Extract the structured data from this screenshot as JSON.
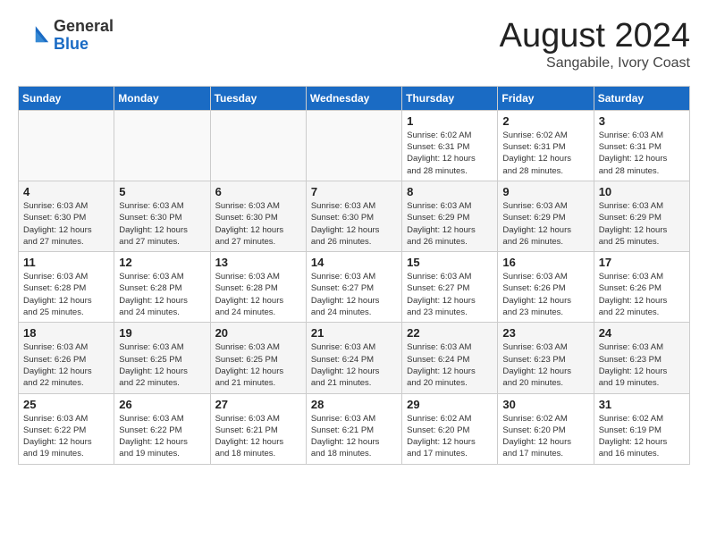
{
  "header": {
    "logo_general": "General",
    "logo_blue": "Blue",
    "month_title": "August 2024",
    "location": "Sangabile, Ivory Coast"
  },
  "calendar": {
    "days_of_week": [
      "Sunday",
      "Monday",
      "Tuesday",
      "Wednesday",
      "Thursday",
      "Friday",
      "Saturday"
    ],
    "weeks": [
      [
        {
          "day": "",
          "info": ""
        },
        {
          "day": "",
          "info": ""
        },
        {
          "day": "",
          "info": ""
        },
        {
          "day": "",
          "info": ""
        },
        {
          "day": "1",
          "info": "Sunrise: 6:02 AM\nSunset: 6:31 PM\nDaylight: 12 hours\nand 28 minutes."
        },
        {
          "day": "2",
          "info": "Sunrise: 6:02 AM\nSunset: 6:31 PM\nDaylight: 12 hours\nand 28 minutes."
        },
        {
          "day": "3",
          "info": "Sunrise: 6:03 AM\nSunset: 6:31 PM\nDaylight: 12 hours\nand 28 minutes."
        }
      ],
      [
        {
          "day": "4",
          "info": "Sunrise: 6:03 AM\nSunset: 6:30 PM\nDaylight: 12 hours\nand 27 minutes."
        },
        {
          "day": "5",
          "info": "Sunrise: 6:03 AM\nSunset: 6:30 PM\nDaylight: 12 hours\nand 27 minutes."
        },
        {
          "day": "6",
          "info": "Sunrise: 6:03 AM\nSunset: 6:30 PM\nDaylight: 12 hours\nand 27 minutes."
        },
        {
          "day": "7",
          "info": "Sunrise: 6:03 AM\nSunset: 6:30 PM\nDaylight: 12 hours\nand 26 minutes."
        },
        {
          "day": "8",
          "info": "Sunrise: 6:03 AM\nSunset: 6:29 PM\nDaylight: 12 hours\nand 26 minutes."
        },
        {
          "day": "9",
          "info": "Sunrise: 6:03 AM\nSunset: 6:29 PM\nDaylight: 12 hours\nand 26 minutes."
        },
        {
          "day": "10",
          "info": "Sunrise: 6:03 AM\nSunset: 6:29 PM\nDaylight: 12 hours\nand 25 minutes."
        }
      ],
      [
        {
          "day": "11",
          "info": "Sunrise: 6:03 AM\nSunset: 6:28 PM\nDaylight: 12 hours\nand 25 minutes."
        },
        {
          "day": "12",
          "info": "Sunrise: 6:03 AM\nSunset: 6:28 PM\nDaylight: 12 hours\nand 24 minutes."
        },
        {
          "day": "13",
          "info": "Sunrise: 6:03 AM\nSunset: 6:28 PM\nDaylight: 12 hours\nand 24 minutes."
        },
        {
          "day": "14",
          "info": "Sunrise: 6:03 AM\nSunset: 6:27 PM\nDaylight: 12 hours\nand 24 minutes."
        },
        {
          "day": "15",
          "info": "Sunrise: 6:03 AM\nSunset: 6:27 PM\nDaylight: 12 hours\nand 23 minutes."
        },
        {
          "day": "16",
          "info": "Sunrise: 6:03 AM\nSunset: 6:26 PM\nDaylight: 12 hours\nand 23 minutes."
        },
        {
          "day": "17",
          "info": "Sunrise: 6:03 AM\nSunset: 6:26 PM\nDaylight: 12 hours\nand 22 minutes."
        }
      ],
      [
        {
          "day": "18",
          "info": "Sunrise: 6:03 AM\nSunset: 6:26 PM\nDaylight: 12 hours\nand 22 minutes."
        },
        {
          "day": "19",
          "info": "Sunrise: 6:03 AM\nSunset: 6:25 PM\nDaylight: 12 hours\nand 22 minutes."
        },
        {
          "day": "20",
          "info": "Sunrise: 6:03 AM\nSunset: 6:25 PM\nDaylight: 12 hours\nand 21 minutes."
        },
        {
          "day": "21",
          "info": "Sunrise: 6:03 AM\nSunset: 6:24 PM\nDaylight: 12 hours\nand 21 minutes."
        },
        {
          "day": "22",
          "info": "Sunrise: 6:03 AM\nSunset: 6:24 PM\nDaylight: 12 hours\nand 20 minutes."
        },
        {
          "day": "23",
          "info": "Sunrise: 6:03 AM\nSunset: 6:23 PM\nDaylight: 12 hours\nand 20 minutes."
        },
        {
          "day": "24",
          "info": "Sunrise: 6:03 AM\nSunset: 6:23 PM\nDaylight: 12 hours\nand 19 minutes."
        }
      ],
      [
        {
          "day": "25",
          "info": "Sunrise: 6:03 AM\nSunset: 6:22 PM\nDaylight: 12 hours\nand 19 minutes."
        },
        {
          "day": "26",
          "info": "Sunrise: 6:03 AM\nSunset: 6:22 PM\nDaylight: 12 hours\nand 19 minutes."
        },
        {
          "day": "27",
          "info": "Sunrise: 6:03 AM\nSunset: 6:21 PM\nDaylight: 12 hours\nand 18 minutes."
        },
        {
          "day": "28",
          "info": "Sunrise: 6:03 AM\nSunset: 6:21 PM\nDaylight: 12 hours\nand 18 minutes."
        },
        {
          "day": "29",
          "info": "Sunrise: 6:02 AM\nSunset: 6:20 PM\nDaylight: 12 hours\nand 17 minutes."
        },
        {
          "day": "30",
          "info": "Sunrise: 6:02 AM\nSunset: 6:20 PM\nDaylight: 12 hours\nand 17 minutes."
        },
        {
          "day": "31",
          "info": "Sunrise: 6:02 AM\nSunset: 6:19 PM\nDaylight: 12 hours\nand 16 minutes."
        }
      ]
    ]
  }
}
